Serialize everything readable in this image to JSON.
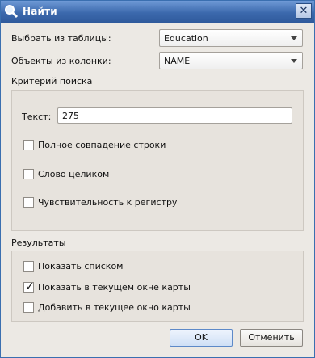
{
  "window": {
    "title": "Найти"
  },
  "table_select": {
    "label": "Выбрать из таблицы:",
    "value": "Education"
  },
  "column_select": {
    "label": "Объекты из колонки:",
    "value": "NAME"
  },
  "criteria": {
    "title": "Критерий поиска",
    "text_label": "Текст:",
    "text_value": "275",
    "options": [
      {
        "label": "Полное совпадение строки",
        "checked": false
      },
      {
        "label": "Слово целиком",
        "checked": false
      },
      {
        "label": "Чувствительность к регистру",
        "checked": false
      }
    ]
  },
  "results": {
    "title": "Результаты",
    "options": [
      {
        "label": "Показать списком",
        "checked": false
      },
      {
        "label": "Показать в текущем окне карты",
        "checked": true
      },
      {
        "label": "Добавить в текущее окно карты",
        "checked": false
      }
    ]
  },
  "buttons": {
    "ok": "OK",
    "cancel": "Отменить"
  }
}
